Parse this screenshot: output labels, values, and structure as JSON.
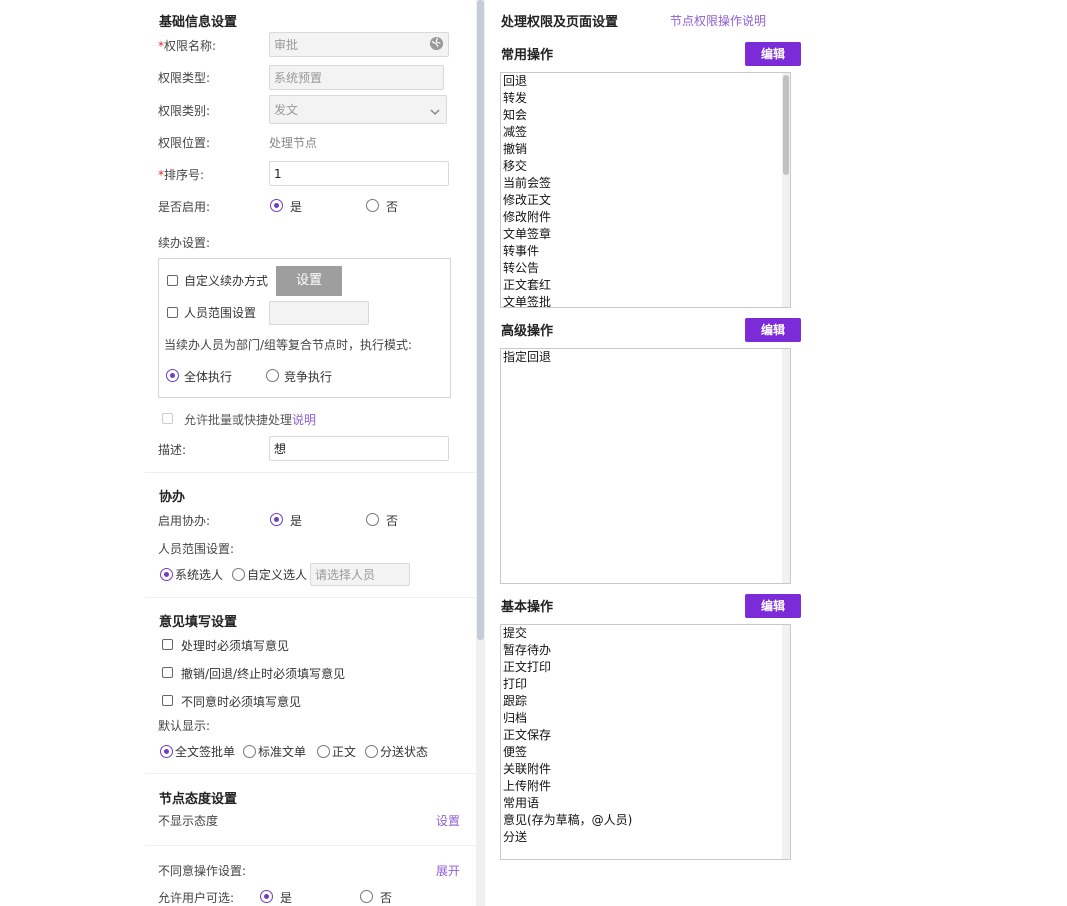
{
  "basic": {
    "title": "基础信息设置",
    "name_label": "权限名称:",
    "name_value": "审批",
    "type_label": "权限类型:",
    "type_value": "系统预置",
    "category_label": "权限类别:",
    "category_value": "发文",
    "position_label": "权限位置:",
    "position_value": "处理节点",
    "order_label": "排序号:",
    "order_value": "1",
    "enabled_label": "是否启用:",
    "yes": "是",
    "no": "否",
    "continue_label": "续办设置:",
    "custom_continue": "自定义续办方式",
    "set_button": "设置",
    "scope_setting": "人员范围设置",
    "compound_note": "当续办人员为部门/组等复合节点时，执行模式:",
    "exec_all": "全体执行",
    "exec_compete": "竞争执行",
    "batch_label": "允许批量或快捷处理",
    "batch_link": "说明",
    "desc_label": "描述:",
    "desc_value": "想"
  },
  "assist": {
    "title": "协办",
    "enable_label": "启用协办:",
    "yes": "是",
    "no": "否",
    "scope_label": "人员范围设置:",
    "system_select": "系统选人",
    "custom_select": "自定义选人",
    "select_placeholder": "请选择人员"
  },
  "opinion": {
    "title": "意见填写设置",
    "must_on_process": "处理时必须填写意见",
    "must_on_cancel": "撤销/回退/终止时必须填写意见",
    "must_on_disagree": "不同意时必须填写意见",
    "default_show_label": "默认显示:",
    "opt_full": "全文签批单",
    "opt_standard": "标准文单",
    "opt_text": "正文",
    "opt_dispatch": "分送状态"
  },
  "attitude": {
    "title": "节点态度设置",
    "hide_label": "不显示态度",
    "set_link": "设置",
    "disagree_label": "不同意操作设置:",
    "expand_link": "展开",
    "user_choose_label": "允许用户可选:",
    "yes": "是",
    "no": "否"
  },
  "right": {
    "title": "处理权限及页面设置",
    "help_link": "节点权限操作说明",
    "common_title": "常用操作",
    "advanced_title": "高级操作",
    "basic_title": "基本操作",
    "edit_label": "编辑",
    "common_items": [
      "回退",
      "转发",
      "知会",
      "减签",
      "撤销",
      "移交",
      "当前会签",
      "修改正文",
      "修改附件",
      "文单签章",
      "转事件",
      "转公告",
      "正文套红",
      "文单签批"
    ],
    "advanced_items": [
      "指定回退"
    ],
    "basic_items": [
      "提交",
      "暂存待办",
      "正文打印",
      "打印",
      "跟踪",
      "归档",
      "正文保存",
      "便签",
      "关联附件",
      "上传附件",
      "常用语",
      "意见(存为草稿，@人员)",
      "分送"
    ]
  },
  "colors": {
    "accent": "#7b2bd8",
    "link": "#8f5fd6",
    "required": "#d9312a"
  }
}
